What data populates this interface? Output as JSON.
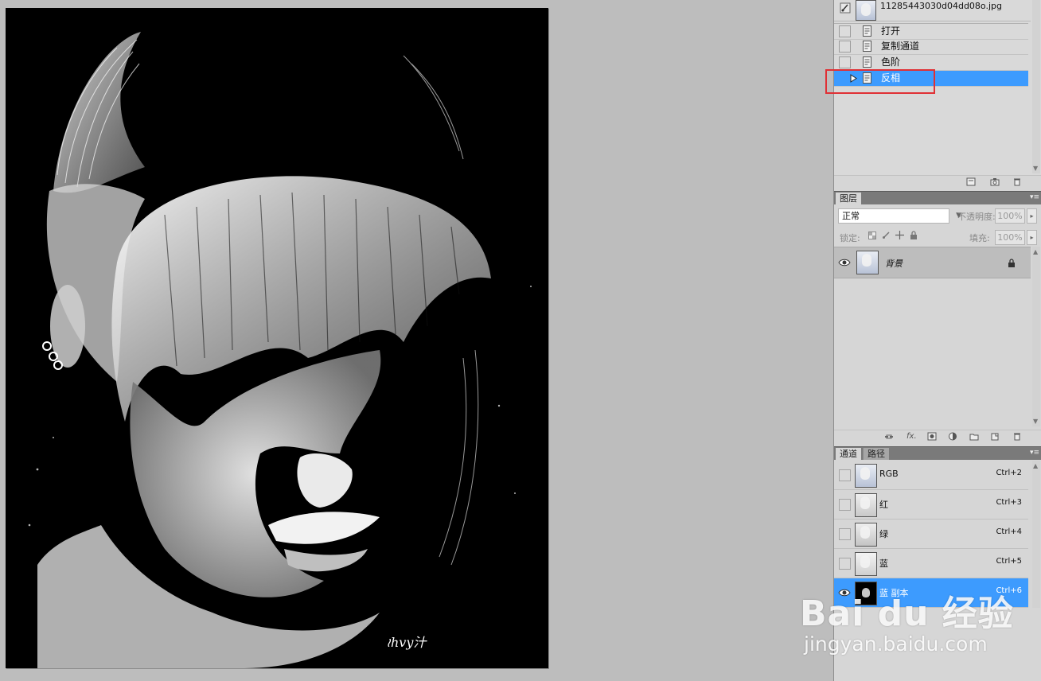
{
  "history": {
    "snapshot_name": "11285443030d04dd08o.jpg",
    "items": [
      {
        "label": "打开",
        "selected": false
      },
      {
        "label": "复制通道",
        "selected": false
      },
      {
        "label": "色阶",
        "selected": false
      },
      {
        "label": "反相",
        "selected": true
      }
    ]
  },
  "layers": {
    "tab_label": "图层",
    "blend_mode": "正常",
    "opacity_label": "不透明度:",
    "opacity_value": "100%",
    "lock_label": "锁定:",
    "fill_label": "填充:",
    "fill_value": "100%",
    "background_layer_name": "背景"
  },
  "channels": {
    "tabs": [
      "通道",
      "路径"
    ],
    "items": [
      {
        "name": "RGB",
        "shortcut": "Ctrl+2",
        "visible": false,
        "selected": false
      },
      {
        "name": "红",
        "shortcut": "Ctrl+3",
        "visible": false,
        "selected": false
      },
      {
        "name": "绿",
        "shortcut": "Ctrl+4",
        "visible": false,
        "selected": false
      },
      {
        "name": "蓝",
        "shortcut": "Ctrl+5",
        "visible": false,
        "selected": false
      },
      {
        "name": "蓝 副本",
        "shortcut": "Ctrl+6",
        "visible": true,
        "selected": true
      }
    ]
  },
  "watermark": {
    "logo": "Bai du 经验",
    "url": "jingyan.baidu.com"
  },
  "colors": {
    "selection": "#3d9bfe",
    "highlight_box": "#e03035",
    "workspace": "#bdbdbd"
  }
}
